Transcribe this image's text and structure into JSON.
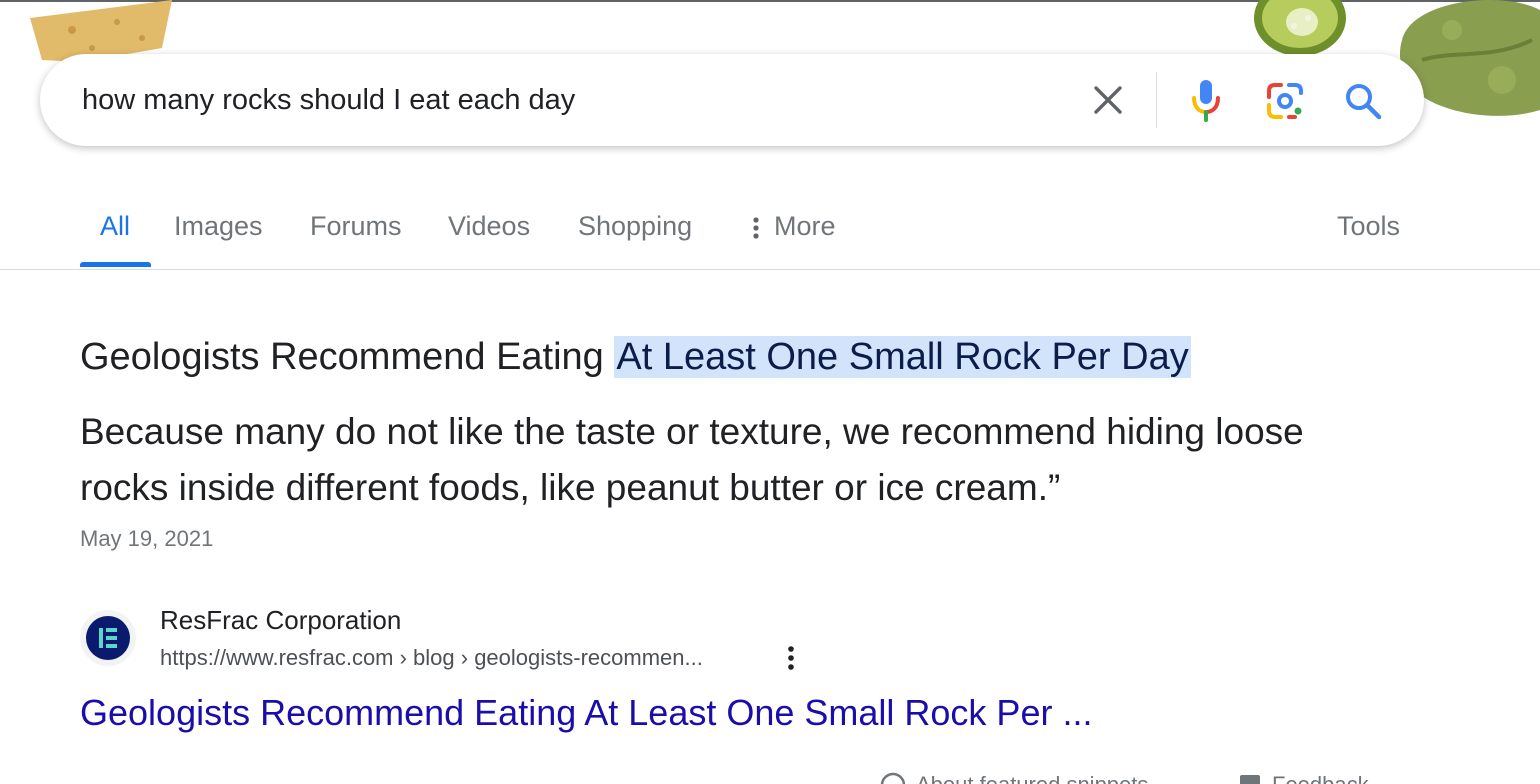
{
  "search": {
    "query": "how many rocks should I eat each day"
  },
  "icons": {
    "clear": "close-icon",
    "voice": "microphone-icon",
    "lens": "camera-lens-icon",
    "search": "search-icon"
  },
  "tabs": [
    {
      "label": "All",
      "active": true
    },
    {
      "label": "Images",
      "active": false
    },
    {
      "label": "Forums",
      "active": false
    },
    {
      "label": "Videos",
      "active": false
    },
    {
      "label": "Shopping",
      "active": false
    },
    {
      "label": "More",
      "active": false
    }
  ],
  "tools_label": "Tools",
  "snippet": {
    "title_prefix": "Geologists Recommend Eating ",
    "title_highlight": "At Least One Small Rock Per Day",
    "body": "Because many do not like the taste or texture, we recommend hiding loose rocks inside different foods, like peanut butter or ice cream.”",
    "date": "May 19, 2021"
  },
  "source": {
    "name": "ResFrac Corporation",
    "url": "https://www.resfrac.com › blog › geologists-recommen...",
    "link_title": "Geologists Recommend Eating At Least One Small Rock Per ..."
  },
  "footer": {
    "about": "About featured snippets",
    "feedback": "Feedback"
  },
  "colors": {
    "accent": "#1a73e8",
    "link": "#1a0dab",
    "highlight": "#d2e3fc"
  }
}
